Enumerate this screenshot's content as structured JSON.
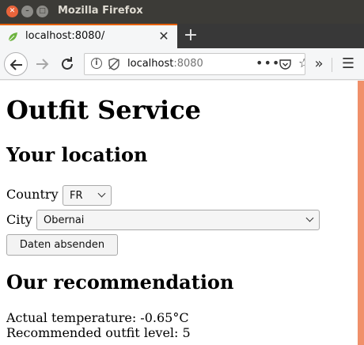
{
  "window": {
    "title": "Mozilla Firefox"
  },
  "tab": {
    "title": "localhost:8080/"
  },
  "urlbar": {
    "host": "localhost",
    "port": ":8080"
  },
  "page": {
    "title": "Outfit Service",
    "location_heading": "Your location",
    "country_label": "Country",
    "country_value": "FR",
    "city_label": "City",
    "city_value": "Obernai",
    "submit_label": "Daten absenden",
    "recommendation_heading": "Our recommendation",
    "temperature_line": "Actual temperature: -0.65°C",
    "outfit_line": "Recommended outfit level: 5"
  },
  "colors": {
    "accent_tab": "#e66000",
    "scrollbar": "#f0906a",
    "titlebar": "#3c3b37"
  },
  "icons": {
    "window_close": "close-icon",
    "window_minimize": "minimize-icon",
    "window_maximize": "maximize-icon",
    "tab_favicon": "leaf-icon",
    "new_tab": "plus-icon",
    "back": "arrow-left-icon",
    "forward": "arrow-right-icon",
    "reload": "reload-icon",
    "site_info": "info-icon",
    "tracking": "tracking-protection-icon",
    "page_actions": "more-icon",
    "pocket": "pocket-icon",
    "bookmark": "star-icon",
    "overflow": "chevron-double-right-icon",
    "menu": "hamburger-icon"
  }
}
